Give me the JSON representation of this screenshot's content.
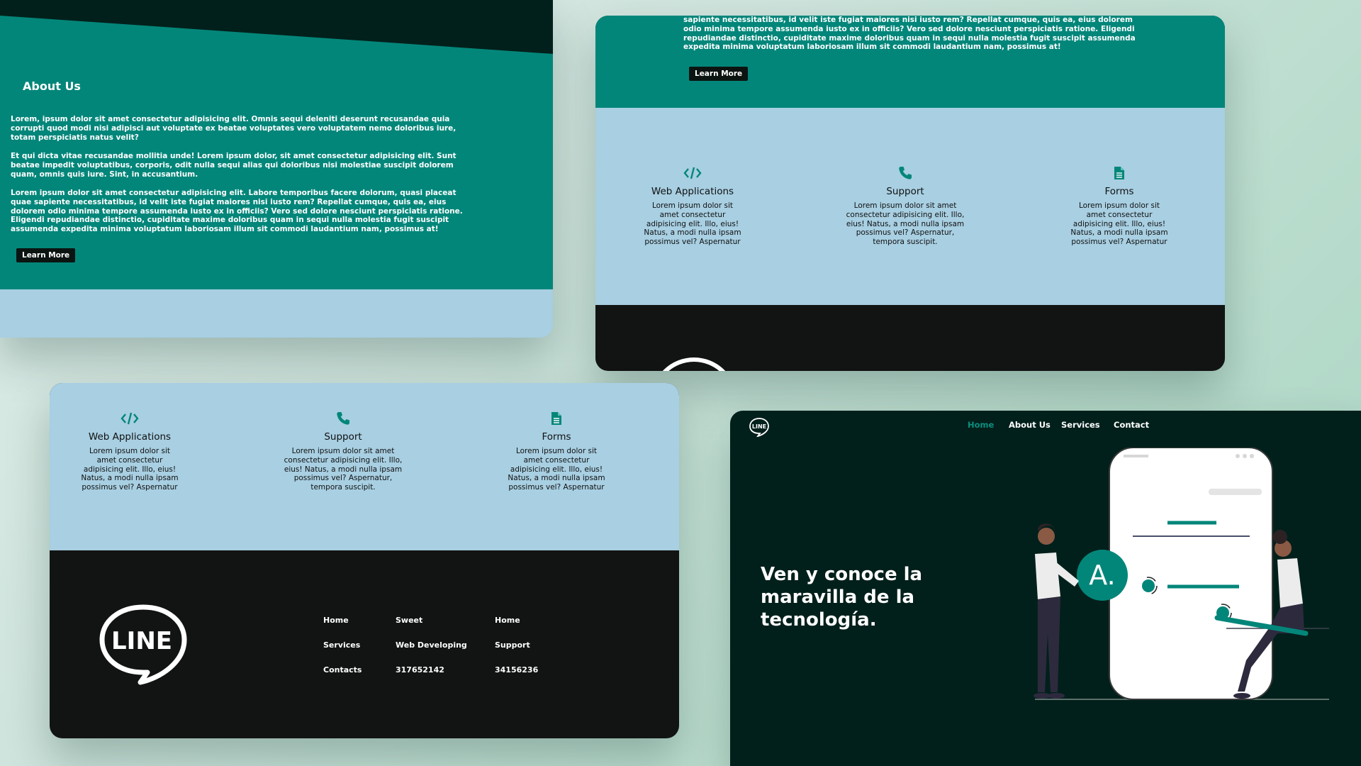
{
  "about": {
    "title": "About Us",
    "paragraphs": [
      "Lorem, ipsum dolor sit amet consectetur adipisicing elit. Omnis sequi deleniti deserunt recusandae quia corrupti quod modi nisi adipisci aut voluptate ex beatae voluptates vero voluptatem nemo doloribus iure, totam perspiciatis natus velit?",
      "Et qui dicta vitae recusandae mollitia unde! Lorem ipsum dolor, sit amet consectetur adipisicing elit. Sunt beatae impedit voluptatibus, corporis, odit nulla sequi alias qui doloribus nisi molestiae suscipit dolorem quam, omnis quis iure. Sint, in accusantium.",
      "Lorem ipsum dolor sit amet consectetur adipisicing elit. Labore temporibus facere dolorum, quasi placeat quae sapiente necessitatibus, id velit iste fugiat maiores nisi iusto rem? Repellat cumque, quis ea, eius dolorem odio minima tempore assumenda iusto ex in officiis? Vero sed dolore nesciunt perspiciatis ratione. Eligendi repudiandae distinctio, cupiditate maxime doloribus quam in sequi nulla molestia fugit suscipit assumenda expedita minima voluptatum laboriosam illum sit commodi laudantium nam, possimus at!"
    ],
    "learn_more": "Learn More"
  },
  "services_top": {
    "partial_paragraph": "sapiente necessitatibus, id velit iste fugiat maiores nisi iusto rem? Repellat cumque, quis ea, eius dolorem odio minima tempore assumenda iusto ex in officiis? Vero sed dolore nesciunt perspiciatis ratione. Eligendi repudiandae distinctio, cupiditate maxime doloribus quam in sequi nulla molestia fugit suscipit assumenda expedita minima voluptatum laboriosam illum sit commodi laudantium nam, possimus at!",
    "learn_more": "Learn More"
  },
  "services": [
    {
      "icon": "code-icon",
      "title": "Web Applications",
      "text": "Lorem ipsum dolor sit amet consectetur adipisicing elit. Illo, eius! Natus, a modi nulla ipsam possimus vel? Aspernatur"
    },
    {
      "icon": "phone-icon",
      "title": "Support",
      "text": "Lorem ipsum dolor sit amet consectetur adipisicing elit. Illo, eius! Natus, a modi nulla ipsam possimus vel? Aspernatur, tempora suscipit."
    },
    {
      "icon": "document-icon",
      "title": "Forms",
      "text": "Lorem ipsum dolor sit amet consectetur adipisicing elit. Illo, eius! Natus, a modi nulla ipsam possimus vel? Aspernatur"
    }
  ],
  "footer": {
    "logo_text": "LINE",
    "columns": [
      [
        "Home",
        "Services",
        "Contacts"
      ],
      [
        "Sweet",
        "Web Developing",
        "317652142"
      ],
      [
        "Home",
        "Support",
        "34156236"
      ]
    ]
  },
  "hero": {
    "logo_text": "LINE",
    "nav": [
      "Home",
      "About Us",
      "Services",
      "Contact"
    ],
    "active_nav": "Home",
    "title": "Ven y conoce la maravilla de la tecnología.",
    "badge_letter": "A."
  },
  "colors": {
    "teal": "#03867a",
    "dark_green": "#02201b",
    "light_blue": "#a8cfe2",
    "footer_black": "#121414"
  }
}
